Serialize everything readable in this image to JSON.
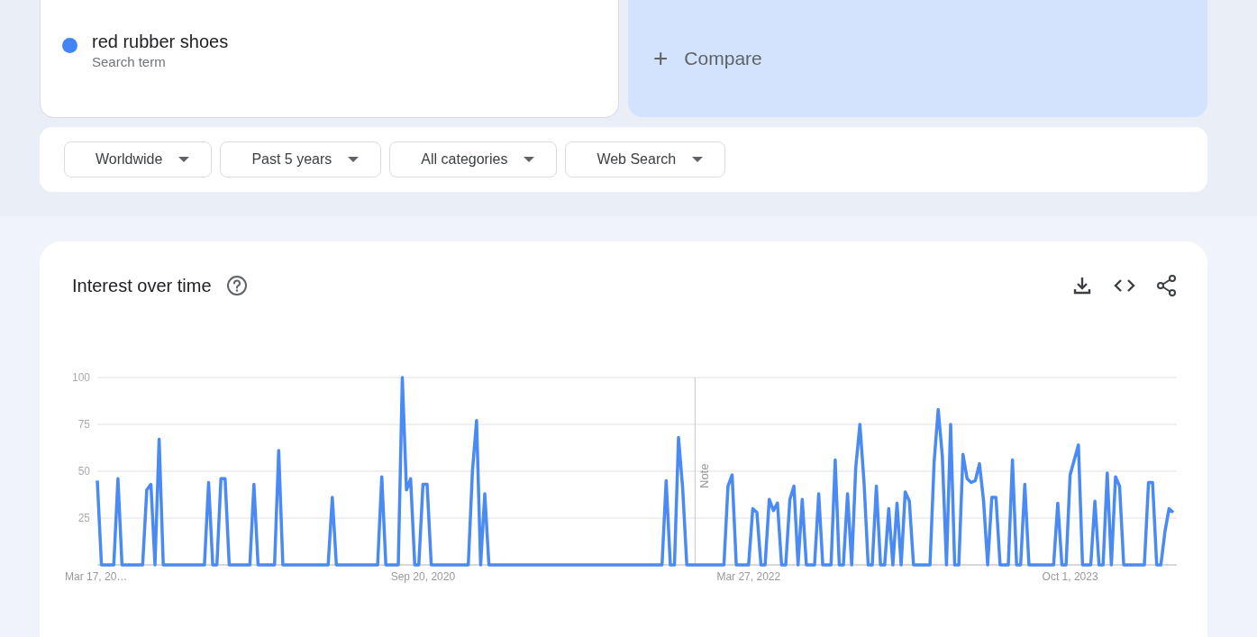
{
  "search_terms": [
    {
      "term": "red rubber shoes",
      "subtitle": "Search term",
      "color": "#4285f4"
    }
  ],
  "compare": {
    "icon": "+",
    "label": "Compare"
  },
  "filters": [
    {
      "label": "Worldwide"
    },
    {
      "label": "Past 5 years"
    },
    {
      "label": "All categories"
    },
    {
      "label": "Web Search"
    }
  ],
  "interest_over_time": {
    "title": "Interest over time",
    "chart_data": {
      "type": "line",
      "grid": true,
      "ylim": [
        0,
        100
      ],
      "yticks": [
        25,
        50,
        75,
        100
      ],
      "categories": [
        "Mar 17, 20…",
        null,
        null,
        null,
        null,
        null,
        null,
        null,
        null,
        null,
        null,
        null,
        null,
        null,
        null,
        null,
        null,
        null,
        null,
        null,
        null,
        null,
        null,
        null,
        null,
        null,
        null,
        null,
        null,
        null,
        null,
        null,
        null,
        null,
        null,
        null,
        null,
        null,
        null,
        null,
        null,
        null,
        null,
        null,
        null,
        null,
        null,
        null,
        null,
        null,
        null,
        null,
        null,
        null,
        null,
        null,
        null,
        null,
        null,
        null,
        null,
        null,
        null,
        null,
        null,
        null,
        null,
        null,
        null,
        null,
        null,
        null,
        null,
        null,
        null,
        null,
        null,
        null,
        null,
        "Sep 20, 2020",
        null,
        null,
        null,
        null,
        null,
        null,
        null,
        null,
        null,
        null,
        null,
        null,
        null,
        null,
        null,
        null,
        null,
        null,
        null,
        null,
        null,
        null,
        null,
        null,
        null,
        null,
        null,
        null,
        null,
        null,
        null,
        null,
        null,
        null,
        null,
        null,
        null,
        null,
        null,
        null,
        null,
        null,
        null,
        null,
        null,
        null,
        null,
        null,
        null,
        null,
        null,
        null,
        null,
        null,
        null,
        null,
        null,
        null,
        null,
        null,
        null,
        null,
        null,
        null,
        null,
        null,
        null,
        null,
        null,
        null,
        null,
        null,
        null,
        null,
        null,
        null,
        null,
        null,
        "Mar 27, 2022",
        null,
        null,
        null,
        null,
        null,
        null,
        null,
        null,
        null,
        null,
        null,
        null,
        null,
        null,
        null,
        null,
        null,
        null,
        null,
        null,
        null,
        null,
        null,
        null,
        null,
        null,
        null,
        null,
        null,
        null,
        null,
        null,
        null,
        null,
        null,
        null,
        null,
        null,
        null,
        null,
        null,
        null,
        null,
        null,
        null,
        null,
        null,
        null,
        null,
        null,
        null,
        null,
        null,
        null,
        null,
        null,
        null,
        null,
        null,
        null,
        null,
        null,
        null,
        null,
        null,
        null,
        null,
        null,
        null,
        null,
        null,
        null,
        null,
        null,
        null,
        null,
        null,
        "Oct 1, 2023",
        null,
        null,
        null,
        null,
        null,
        null,
        null,
        null,
        null,
        null,
        null,
        null,
        null,
        null,
        null,
        null,
        null,
        null,
        null,
        null,
        null,
        null,
        null,
        null,
        null
      ],
      "series": [
        {
          "color": "#4a8af4",
          "values": [
            45,
            0,
            0,
            0,
            0,
            46,
            0,
            0,
            0,
            0,
            0,
            0,
            40,
            43,
            0,
            67,
            0,
            0,
            0,
            0,
            0,
            0,
            0,
            0,
            0,
            0,
            0,
            44,
            0,
            0,
            46,
            46,
            0,
            0,
            0,
            0,
            0,
            0,
            43,
            0,
            0,
            0,
            0,
            0,
            61,
            0,
            0,
            0,
            0,
            0,
            0,
            0,
            0,
            0,
            0,
            0,
            0,
            36,
            0,
            0,
            0,
            0,
            0,
            0,
            0,
            0,
            0,
            0,
            0,
            47,
            0,
            0,
            0,
            0,
            100,
            40,
            46,
            0,
            0,
            43,
            43,
            0,
            0,
            0,
            0,
            0,
            0,
            0,
            0,
            0,
            0,
            50,
            77,
            0,
            38,
            0,
            0,
            0,
            0,
            0,
            0,
            0,
            0,
            0,
            0,
            0,
            0,
            0,
            0,
            0,
            0,
            0,
            0,
            0,
            0,
            0,
            0,
            0,
            0,
            0,
            0,
            0,
            0,
            0,
            0,
            0,
            0,
            0,
            0,
            0,
            0,
            0,
            0,
            0,
            0,
            0,
            0,
            0,
            45,
            0,
            0,
            68,
            41,
            0,
            0,
            0,
            0,
            0,
            0,
            0,
            0,
            0,
            0,
            42,
            48,
            0,
            0,
            0,
            0,
            30,
            28,
            0,
            0,
            35,
            29,
            33,
            0,
            0,
            35,
            42,
            0,
            35,
            0,
            0,
            0,
            38,
            0,
            0,
            0,
            56,
            0,
            0,
            38,
            0,
            52,
            75,
            44,
            0,
            0,
            42,
            0,
            0,
            30,
            0,
            33,
            0,
            39,
            34,
            0,
            0,
            0,
            0,
            0,
            55,
            83,
            58,
            0,
            75,
            0,
            0,
            59,
            46,
            44,
            45,
            54,
            34,
            0,
            36,
            36,
            0,
            0,
            0,
            56,
            0,
            0,
            43,
            0,
            0,
            0,
            0,
            0,
            0,
            0,
            33,
            0,
            0,
            48,
            56,
            64,
            0,
            0,
            0,
            34,
            0,
            0,
            49,
            0,
            47,
            42,
            0,
            0,
            0,
            0,
            0,
            0,
            44,
            44,
            0,
            0,
            18,
            30,
            28
          ]
        }
      ],
      "annotations": [
        "Note"
      ]
    }
  }
}
